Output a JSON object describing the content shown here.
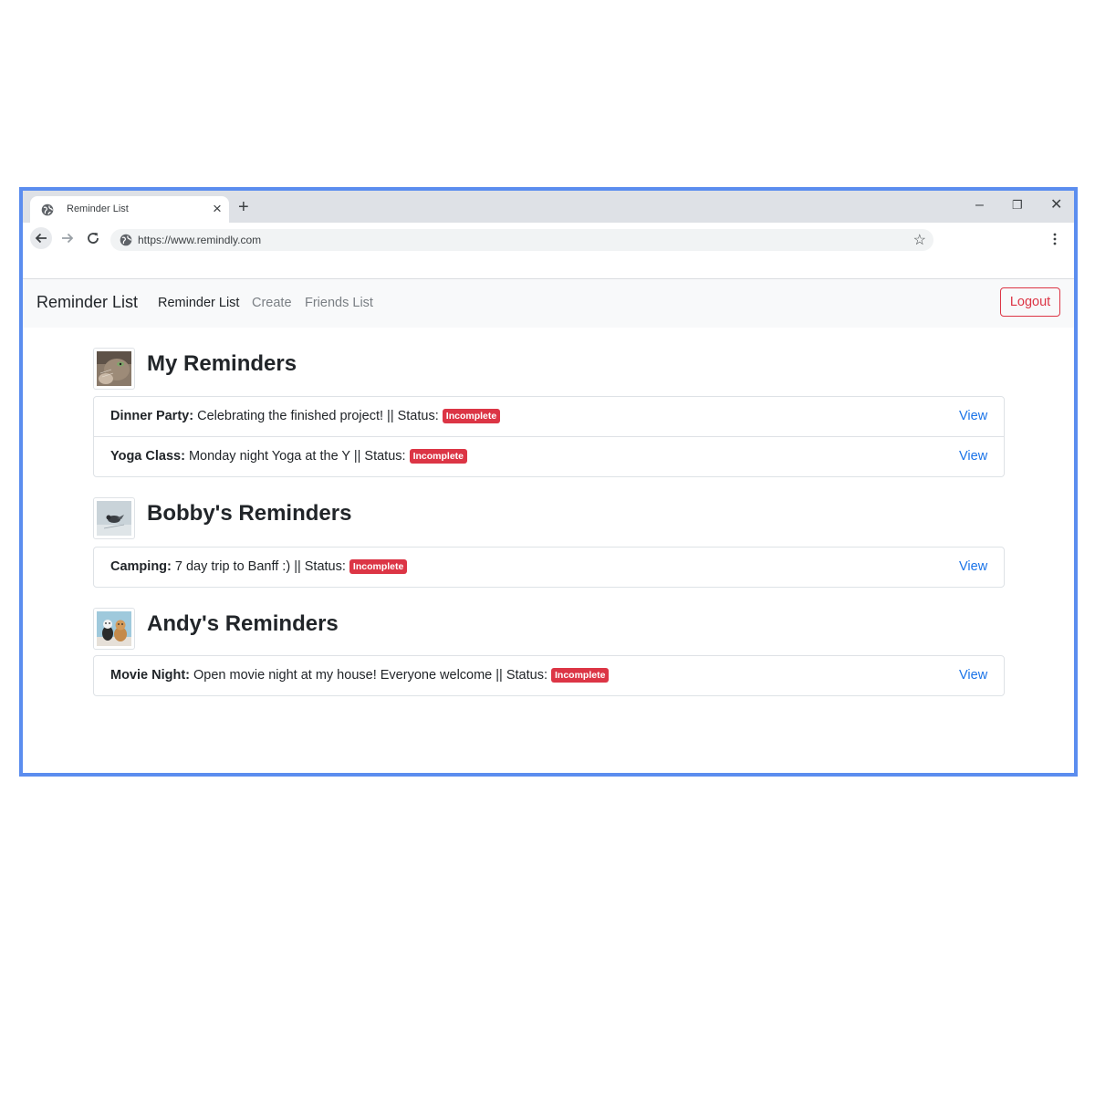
{
  "browser": {
    "tab_title": "Reminder List",
    "tab_close": "×",
    "new_tab": "+",
    "url": "https://www.remindly.com",
    "window_controls": {
      "minimize": "–",
      "restore": "❐",
      "close": "✕"
    },
    "bookmark_star": "☆"
  },
  "navbar": {
    "brand": "Reminder List",
    "links": [
      {
        "label": "Reminder List",
        "active": true
      },
      {
        "label": "Create",
        "active": false
      },
      {
        "label": "Friends List",
        "active": false
      }
    ],
    "logout_label": "Logout"
  },
  "sections": [
    {
      "title": "My Reminders",
      "avatar_icon": "cat-photo",
      "items": [
        {
          "title": "Dinner Party:",
          "description": " Celebrating the finished project! || Status: ",
          "status": "Incomplete",
          "action": "View"
        },
        {
          "title": "Yoga Class:",
          "description": " Monday night Yoga at the Y || Status: ",
          "status": "Incomplete",
          "action": "View"
        }
      ]
    },
    {
      "title": "Bobby's Reminders",
      "avatar_icon": "bird-in-snow-photo",
      "items": [
        {
          "title": "Camping:",
          "description": " 7 day trip to Banff :) || Status: ",
          "status": "Incomplete",
          "action": "View"
        }
      ]
    },
    {
      "title": "Andy's Reminders",
      "avatar_icon": "cat-and-dog-photo",
      "items": [
        {
          "title": "Movie Night:",
          "description": " Open movie night at my house! Everyone welcome || Status: ",
          "status": "Incomplete",
          "action": "View"
        }
      ]
    }
  ],
  "colors": {
    "frame_border": "#5b8def",
    "badge_danger": "#dc3545",
    "link_blue": "#1a73e8",
    "navbar_bg": "#f8f9fa"
  }
}
